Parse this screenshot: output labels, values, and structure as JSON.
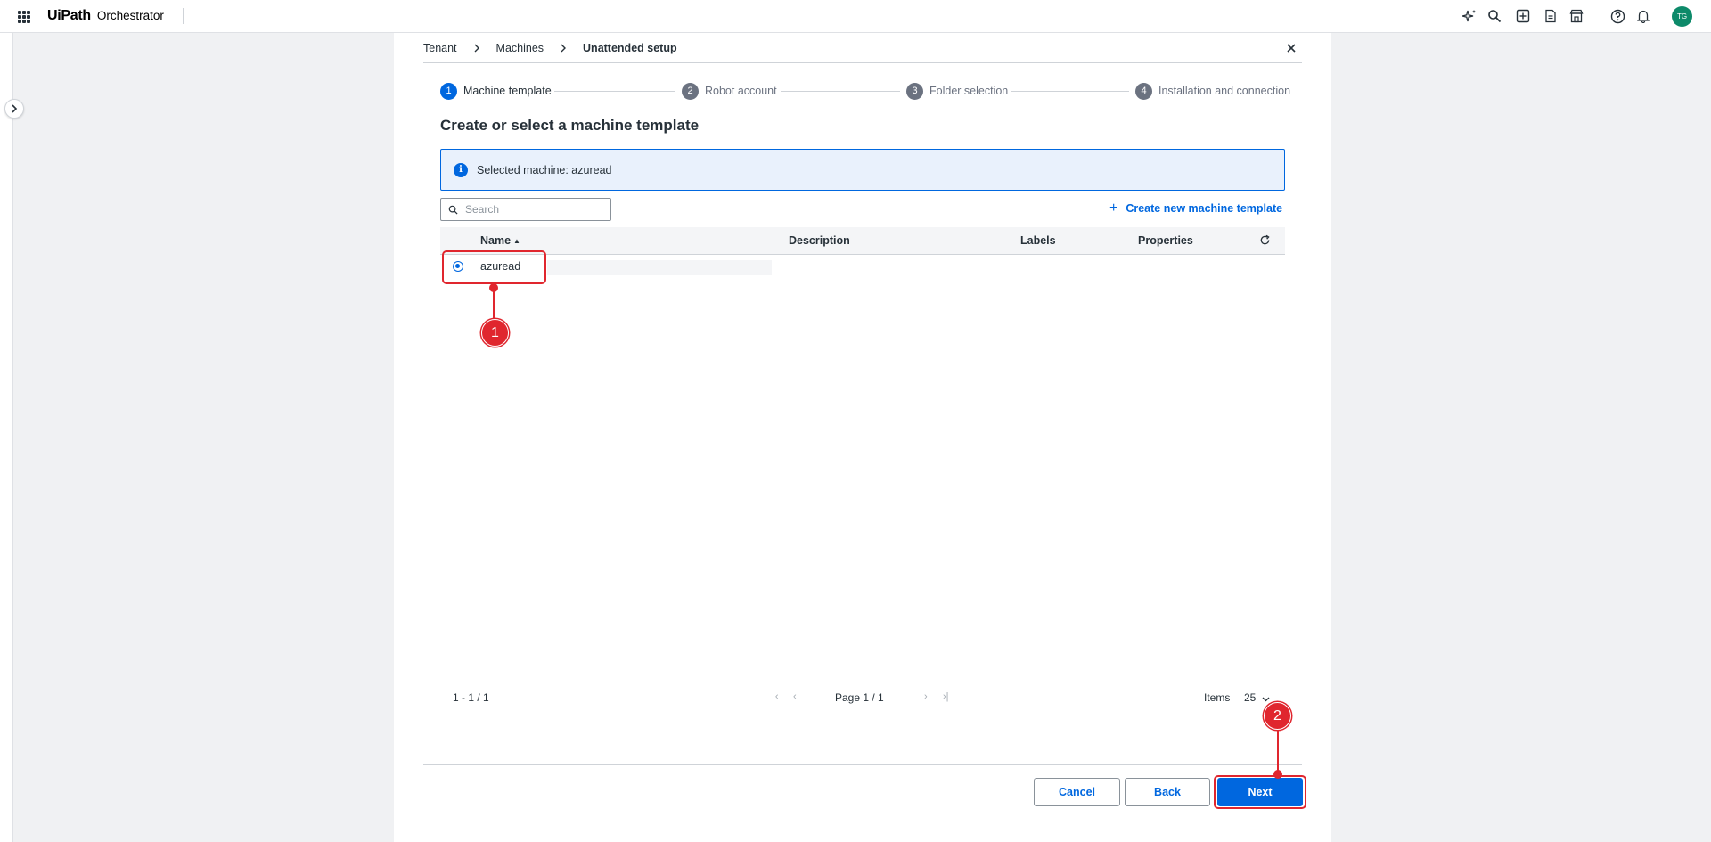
{
  "topbar": {
    "brand_logo": "UiPath",
    "brand_app": "Orchestrator",
    "icons": [
      "sparkle-icon",
      "search-icon",
      "add-box-icon",
      "document-icon",
      "store-icon",
      "help-icon",
      "bell-icon"
    ],
    "avatar_initials": "TG"
  },
  "breadcrumb": {
    "items": [
      "Tenant",
      "Machines",
      "Unattended setup"
    ]
  },
  "stepper": {
    "steps": [
      {
        "num": "1",
        "label": "Machine template"
      },
      {
        "num": "2",
        "label": "Robot account"
      },
      {
        "num": "3",
        "label": "Folder selection"
      },
      {
        "num": "4",
        "label": "Installation and connection"
      }
    ]
  },
  "page": {
    "heading": "Create or select a machine template",
    "info_text": "Selected machine: azuread",
    "search_placeholder": "Search",
    "create_link": "Create new machine template"
  },
  "table": {
    "columns": [
      "Name",
      "Description",
      "Labels",
      "Properties"
    ],
    "rows": [
      {
        "name": "azuread",
        "description": "",
        "labels": "",
        "properties": ""
      }
    ]
  },
  "pagination": {
    "range": "1 - 1 / 1",
    "page": "Page 1 / 1",
    "items_label": "Items",
    "items_value": "25"
  },
  "footer": {
    "cancel": "Cancel",
    "back": "Back",
    "next": "Next"
  },
  "annotations": [
    "1",
    "2"
  ],
  "colors": {
    "accent": "#0067df",
    "annotation": "#e0262e",
    "avatar": "#0d8a6a"
  }
}
